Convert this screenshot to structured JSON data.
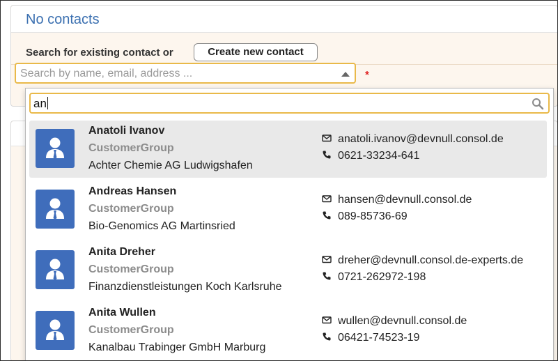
{
  "panel": {
    "title": "No contacts",
    "search_label": "Search for existing contact or",
    "create_button": "Create new contact",
    "search_placeholder": "Search by name, email, address ...",
    "required_marker": "*"
  },
  "dropdown": {
    "filter_value": "an",
    "results": [
      {
        "name": "Anatoli Ivanov",
        "group": "CustomerGroup",
        "company": "Achter Chemie AG Ludwigshafen",
        "email": "anatoli.ivanov@devnull.consol.de",
        "phone": "0621-33234-641",
        "highlighted": true
      },
      {
        "name": "Andreas Hansen",
        "group": "CustomerGroup",
        "company": "Bio-Genomics AG Martinsried",
        "email": "hansen@devnull.consol.de",
        "phone": "089-85736-69",
        "highlighted": false
      },
      {
        "name": "Anita Dreher",
        "group": "CustomerGroup",
        "company": "Finanzdienstleistungen Koch Karlsruhe",
        "email": "dreher@devnull.consol.de-experts.de",
        "phone": "0721-262972-198",
        "highlighted": false
      },
      {
        "name": "Anita Wullen",
        "group": "CustomerGroup",
        "company": "Kanalbau Trabinger GmbH Marburg",
        "email": "wullen@devnull.consol.de",
        "phone": "06421-74523-19",
        "highlighted": false
      }
    ]
  },
  "icons": {
    "avatar": "person-avatar-icon",
    "email": "envelope-icon",
    "phone": "phone-icon",
    "search": "magnifier-icon",
    "caret": "caret-up-icon"
  },
  "colors": {
    "accent": "#3a6fb0",
    "avatar_bg": "#3f6dbb",
    "focus_border": "#e9b949",
    "panel_bg": "#fdf6ee",
    "highlight_row": "#e9e9e9",
    "required": "#e02020"
  }
}
